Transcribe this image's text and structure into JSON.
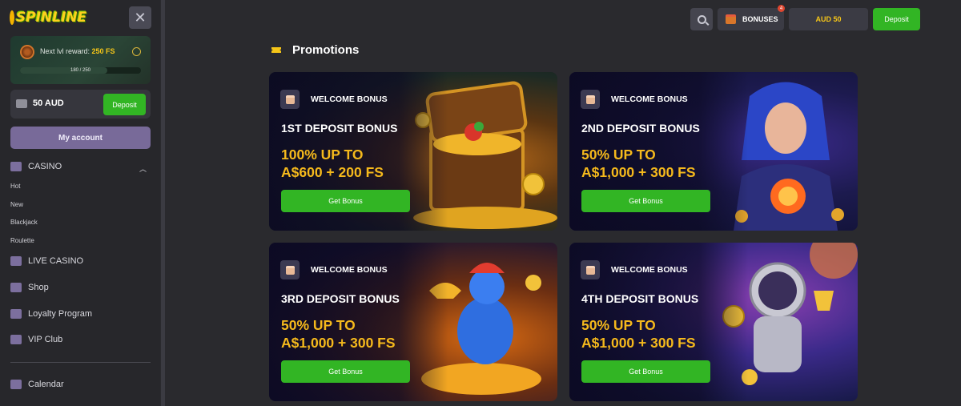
{
  "brand": {
    "logo_text": "SPINLINE"
  },
  "sidebar": {
    "reward": {
      "label": "Next lvl reward:",
      "value": "250 FS",
      "progress_text": "180 / 250",
      "progress_fraction": 0.72
    },
    "balance": {
      "amount": "50 AUD",
      "deposit_label": "Deposit"
    },
    "account_label": "My account",
    "casino_label": "CASINO",
    "casino_subitems": [
      "Hot",
      "New",
      "Blackjack",
      "Roulette"
    ],
    "items": [
      {
        "label": "LIVE CASINO",
        "icon": "crown-icon"
      },
      {
        "label": "Shop",
        "icon": "basket-icon"
      },
      {
        "label": "Loyalty Program",
        "icon": "diamond-icon"
      },
      {
        "label": "VIP Club",
        "icon": "crown-icon"
      },
      {
        "label": "Calendar",
        "icon": "calendar-icon"
      }
    ]
  },
  "header": {
    "bonuses_label": "BONUSES",
    "bonuses_count": "4",
    "balance_label": "AUD 50",
    "deposit_label": "Deposit"
  },
  "page": {
    "title": "Promotions"
  },
  "promos": [
    {
      "tag": "WELCOME BONUS",
      "title": "1ST DEPOSIT BONUS",
      "offer_line1": "100% UP TO",
      "offer_line2": "A$600 + 200 FS",
      "button": "Get Bonus"
    },
    {
      "tag": "WELCOME BONUS",
      "title": "2ND DEPOSIT BONUS",
      "offer_line1": "50% UP TO",
      "offer_line2": "A$1,000 + 300 FS",
      "button": "Get Bonus"
    },
    {
      "tag": "WELCOME BONUS",
      "title": "3RD DEPOSIT BONUS",
      "offer_line1": "50% UP TO",
      "offer_line2": "A$1,000 + 300 FS",
      "button": "Get Bonus"
    },
    {
      "tag": "WELCOME BONUS",
      "title": "4TH DEPOSIT BONUS",
      "offer_line1": "50% UP TO",
      "offer_line2": "A$1,000 + 300 FS",
      "button": "Get Bonus"
    }
  ],
  "colors": {
    "accent_green": "#32b524",
    "gold": "#f5b91c",
    "purple": "#786a99",
    "background": "#2a2a2e"
  }
}
